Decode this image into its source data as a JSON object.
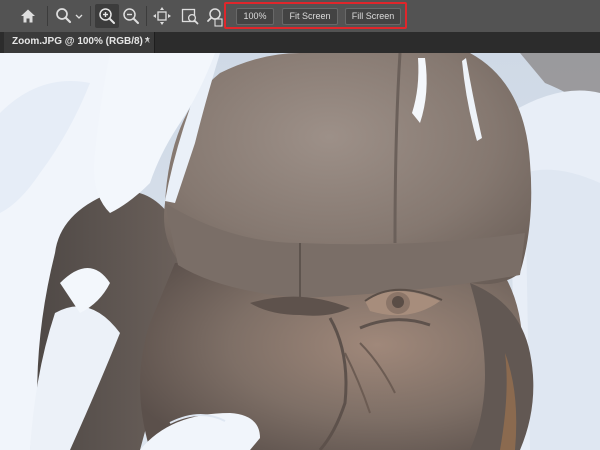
{
  "options_bar": {
    "tools": [
      {
        "name": "home-icon"
      },
      {
        "name": "zoom-tool-icon"
      },
      {
        "name": "zoom-in-icon"
      },
      {
        "name": "zoom-out-icon"
      },
      {
        "name": "resize-windows-icon"
      },
      {
        "name": "zoom-all-windows-icon"
      },
      {
        "name": "scrubby-zoom-icon"
      }
    ],
    "zoom_buttons": {
      "percent_label": "100%",
      "fit_label": "Fit Screen",
      "fill_label": "Fill Screen"
    },
    "highlight_color": "#e0262b"
  },
  "document_tab": {
    "title": "Zoom.JPG @ 100% (RGB/8) *",
    "close_glyph": "×"
  },
  "canvas": {
    "image_subject": "snow-covered stone statue head"
  }
}
